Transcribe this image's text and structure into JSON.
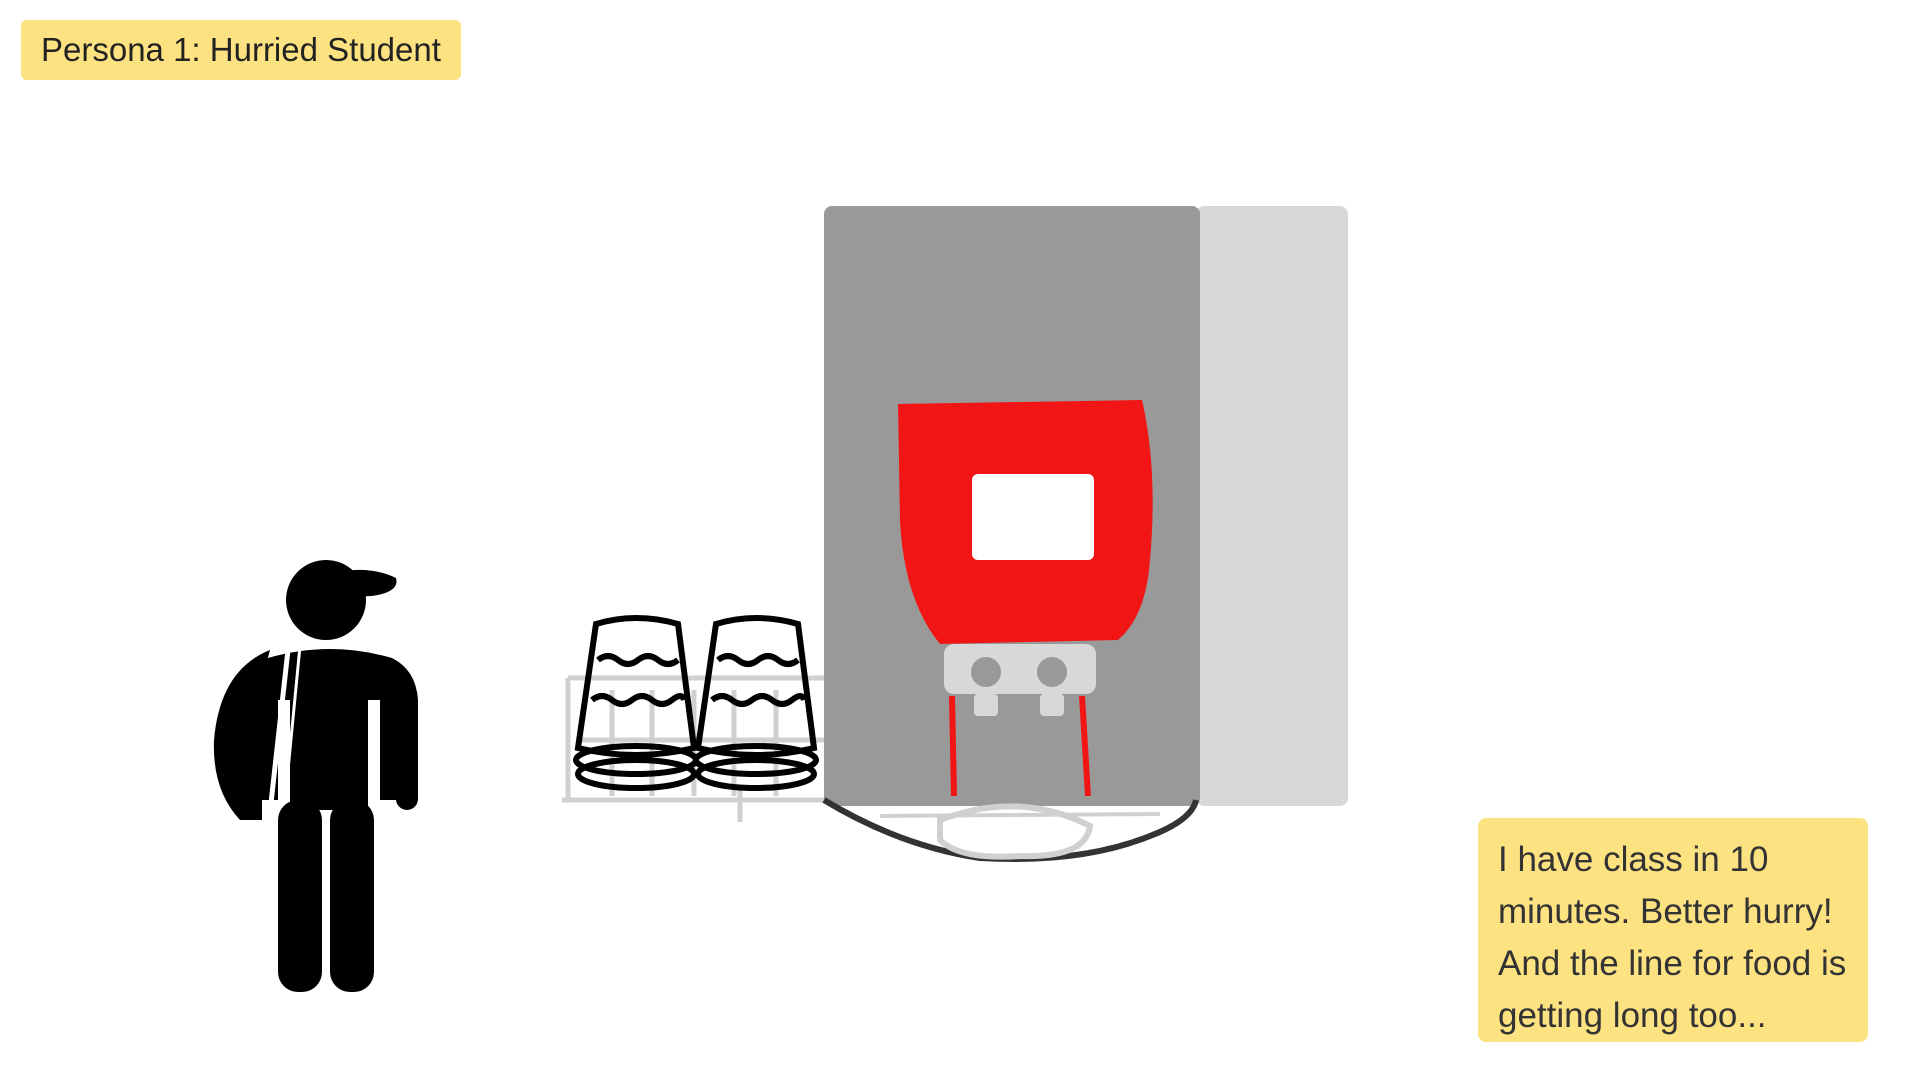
{
  "persona": {
    "title": "Persona 1: Hurried Student"
  },
  "speech_note": {
    "text": "I have class in 10 minutes. Better hurry! And the line for food is getting long too..."
  },
  "colors": {
    "sticky_background": "#fde281",
    "machine_body": "#999999",
    "machine_side": "#d8d8d8",
    "machine_panel": "#f21515",
    "figure": "#000000"
  },
  "icons": {
    "figure": "student-with-backpack-icon",
    "cups": "stacked-cups-icon",
    "machine": "drink-dispenser-illustration"
  }
}
